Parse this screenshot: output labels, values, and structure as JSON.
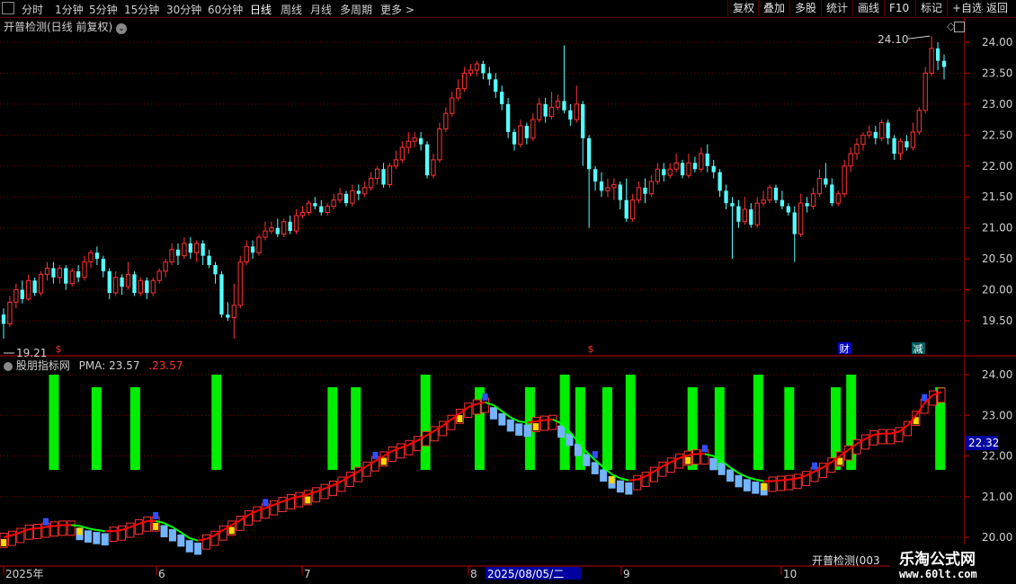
{
  "toolbar": {
    "periods": [
      "分时",
      "1分钟",
      "5分钟",
      "15分钟",
      "30分钟",
      "60分钟",
      "日线",
      "周线",
      "月线",
      "多周期",
      "更多"
    ],
    "active_period": "日线",
    "right_buttons": [
      "复权",
      "叠加",
      "多股",
      "统计",
      "画线",
      "F10",
      "标记",
      "+自选",
      "返回"
    ]
  },
  "main_chart": {
    "title": "开普检测(日线 前复权)",
    "high_label": "24.10",
    "low_label": "19.21",
    "markers": {
      "finance": "财",
      "reduce": "减",
      "dividend": "$"
    }
  },
  "indicator": {
    "name": "股朋指标网",
    "label": "PMA:",
    "value": "23.57",
    "value2": "23.57",
    "current_price_tag": "22.32"
  },
  "stock_label": "开普检测(003",
  "watermark": {
    "line1": "乐淘公式网",
    "line2": "www.60lt.com"
  },
  "colors": {
    "up": "#ff3232",
    "down": "#54ffff",
    "grid": "#7a0000",
    "axis": "#c00000",
    "pma_up": "#ff0000",
    "pma_down": "#00ff00",
    "bar_green": "#00ee00"
  },
  "chart_data": {
    "type": "candlestick",
    "price_axis_ticks": [
      "24.00",
      "23.50",
      "23.00",
      "22.50",
      "22.00",
      "21.50",
      "21.00",
      "20.50",
      "20.00",
      "19.50"
    ],
    "indicator_axis_ticks": [
      "24.00",
      "23.00",
      "22.00",
      "21.00",
      "20.00"
    ],
    "x_ticks": [
      "2025年",
      "6",
      "7",
      "8",
      "9",
      "10"
    ],
    "cursor_date": "2025/08/05/二",
    "candles": [
      [
        19.6,
        19.45,
        19.7,
        19.21
      ],
      [
        19.45,
        19.8,
        19.9,
        19.4
      ],
      [
        19.8,
        20.0,
        20.1,
        19.7
      ],
      [
        20.0,
        19.85,
        20.15,
        19.78
      ],
      [
        19.85,
        20.15,
        20.25,
        19.82
      ],
      [
        20.15,
        19.95,
        20.2,
        19.9
      ],
      [
        19.95,
        20.25,
        20.3,
        19.9
      ],
      [
        20.25,
        20.35,
        20.45,
        20.15
      ],
      [
        20.35,
        20.2,
        20.45,
        20.1
      ],
      [
        20.2,
        20.35,
        20.4,
        20.1
      ],
      [
        20.35,
        20.1,
        20.4,
        20.0
      ],
      [
        20.1,
        20.3,
        20.35,
        20.05
      ],
      [
        20.3,
        20.2,
        20.4,
        20.12
      ],
      [
        20.2,
        20.45,
        20.55,
        20.15
      ],
      [
        20.45,
        20.6,
        20.65,
        20.35
      ],
      [
        20.6,
        20.5,
        20.7,
        20.4
      ],
      [
        20.5,
        20.3,
        20.55,
        20.2
      ],
      [
        20.3,
        19.95,
        20.35,
        19.85
      ],
      [
        19.95,
        20.2,
        20.3,
        19.9
      ],
      [
        20.2,
        20.05,
        20.25,
        19.92
      ],
      [
        20.05,
        20.25,
        20.45,
        20.0
      ],
      [
        20.25,
        19.95,
        20.3,
        19.9
      ],
      [
        19.95,
        20.15,
        20.2,
        19.9
      ],
      [
        20.15,
        19.95,
        20.2,
        19.85
      ],
      [
        19.95,
        20.15,
        20.2,
        19.9
      ],
      [
        20.15,
        20.3,
        20.35,
        20.1
      ],
      [
        20.3,
        20.45,
        20.5,
        20.2
      ],
      [
        20.45,
        20.65,
        20.75,
        20.4
      ],
      [
        20.65,
        20.55,
        20.75,
        20.4
      ],
      [
        20.55,
        20.75,
        20.85,
        20.5
      ],
      [
        20.75,
        20.6,
        20.85,
        20.5
      ],
      [
        20.6,
        20.75,
        20.8,
        20.45
      ],
      [
        20.75,
        20.55,
        20.8,
        20.4
      ],
      [
        20.55,
        20.4,
        20.65,
        20.35
      ],
      [
        20.4,
        20.25,
        20.45,
        20.1
      ],
      [
        20.25,
        19.6,
        20.3,
        19.55
      ],
      [
        19.6,
        19.55,
        19.8,
        19.5
      ],
      [
        19.55,
        19.75,
        20.1,
        19.21
      ],
      [
        19.75,
        20.45,
        20.55,
        19.7
      ],
      [
        20.45,
        20.7,
        20.8,
        20.4
      ],
      [
        20.7,
        20.6,
        20.8,
        20.5
      ],
      [
        20.6,
        20.85,
        20.9,
        20.55
      ],
      [
        20.85,
        20.95,
        21.1,
        20.8
      ],
      [
        20.95,
        21.0,
        21.1,
        20.9
      ],
      [
        21.0,
        20.9,
        21.15,
        20.85
      ],
      [
        20.9,
        21.1,
        21.15,
        20.85
      ],
      [
        21.1,
        20.95,
        21.2,
        20.9
      ],
      [
        20.95,
        21.2,
        21.3,
        20.9
      ],
      [
        21.2,
        21.25,
        21.35,
        21.15
      ],
      [
        21.25,
        21.4,
        21.45,
        21.2
      ],
      [
        21.4,
        21.35,
        21.5,
        21.3
      ],
      [
        21.35,
        21.25,
        21.45,
        21.2
      ],
      [
        21.25,
        21.35,
        21.4,
        21.2
      ],
      [
        21.35,
        21.45,
        21.55,
        21.3
      ],
      [
        21.45,
        21.55,
        21.65,
        21.4
      ],
      [
        21.55,
        21.4,
        21.6,
        21.35
      ],
      [
        21.4,
        21.6,
        21.7,
        21.35
      ],
      [
        21.6,
        21.55,
        21.7,
        21.45
      ],
      [
        21.55,
        21.65,
        21.75,
        21.5
      ],
      [
        21.65,
        21.8,
        21.9,
        21.6
      ],
      [
        21.8,
        21.95,
        22.0,
        21.7
      ],
      [
        21.95,
        21.7,
        22.05,
        21.65
      ],
      [
        21.7,
        22.0,
        22.05,
        21.65
      ],
      [
        22.0,
        22.1,
        22.25,
        21.95
      ],
      [
        22.1,
        22.3,
        22.4,
        22.05
      ],
      [
        22.3,
        22.4,
        22.55,
        22.2
      ],
      [
        22.4,
        22.45,
        22.55,
        22.3
      ],
      [
        22.45,
        22.35,
        22.55,
        22.25
      ],
      [
        22.35,
        21.85,
        22.4,
        21.8
      ],
      [
        21.85,
        22.1,
        22.2,
        21.8
      ],
      [
        22.1,
        22.6,
        22.7,
        22.05
      ],
      [
        22.6,
        22.85,
        22.95,
        22.55
      ],
      [
        22.85,
        23.1,
        23.2,
        22.8
      ],
      [
        23.1,
        23.25,
        23.4,
        23.05
      ],
      [
        23.25,
        23.5,
        23.6,
        23.2
      ],
      [
        23.5,
        23.55,
        23.65,
        23.45
      ],
      [
        23.55,
        23.65,
        23.7,
        23.45
      ],
      [
        23.65,
        23.5,
        23.7,
        23.4
      ],
      [
        23.5,
        23.4,
        23.6,
        23.3
      ],
      [
        23.4,
        23.2,
        23.5,
        23.1
      ],
      [
        23.2,
        23.0,
        23.3,
        22.9
      ],
      [
        23.0,
        22.55,
        23.1,
        22.45
      ],
      [
        22.55,
        22.35,
        22.6,
        22.25
      ],
      [
        22.35,
        22.65,
        22.75,
        22.3
      ],
      [
        22.65,
        22.45,
        22.7,
        22.35
      ],
      [
        22.45,
        22.75,
        22.85,
        22.4
      ],
      [
        22.75,
        23.0,
        23.1,
        22.7
      ],
      [
        23.0,
        22.8,
        23.1,
        22.7
      ],
      [
        22.8,
        22.95,
        23.2,
        22.75
      ],
      [
        22.95,
        23.05,
        23.15,
        22.9
      ],
      [
        23.05,
        22.9,
        23.95,
        22.85
      ],
      [
        22.9,
        22.75,
        23.0,
        22.65
      ],
      [
        22.75,
        23.0,
        23.3,
        22.7
      ],
      [
        23.0,
        22.45,
        23.05,
        22.0
      ],
      [
        22.45,
        21.95,
        22.5,
        21.0
      ],
      [
        21.95,
        21.75,
        22.0,
        21.6
      ],
      [
        21.75,
        21.6,
        21.9,
        21.5
      ],
      [
        21.6,
        21.65,
        21.8,
        21.5
      ],
      [
        21.65,
        21.7,
        21.8,
        21.45
      ],
      [
        21.7,
        21.45,
        21.75,
        21.3
      ],
      [
        21.45,
        21.15,
        21.8,
        21.1
      ],
      [
        21.15,
        21.45,
        21.55,
        21.1
      ],
      [
        21.45,
        21.65,
        21.75,
        21.4
      ],
      [
        21.65,
        21.55,
        21.8,
        21.4
      ],
      [
        21.55,
        21.75,
        21.85,
        21.5
      ],
      [
        21.75,
        21.95,
        22.05,
        21.7
      ],
      [
        21.95,
        21.85,
        22.05,
        21.75
      ],
      [
        21.85,
        21.95,
        22.05,
        21.8
      ],
      [
        21.95,
        22.05,
        22.2,
        21.9
      ],
      [
        22.05,
        21.85,
        22.1,
        21.8
      ],
      [
        21.85,
        22.05,
        22.2,
        21.8
      ],
      [
        22.05,
        21.95,
        22.15,
        21.9
      ],
      [
        21.95,
        22.2,
        22.3,
        21.9
      ],
      [
        22.2,
        22.0,
        22.35,
        21.9
      ],
      [
        22.0,
        21.9,
        22.1,
        21.8
      ],
      [
        21.9,
        21.6,
        21.95,
        21.5
      ],
      [
        21.6,
        21.4,
        21.7,
        21.3
      ],
      [
        21.4,
        21.35,
        21.5,
        20.5
      ],
      [
        21.35,
        21.1,
        21.45,
        21.0
      ],
      [
        21.1,
        21.3,
        21.5,
        21.05
      ],
      [
        21.3,
        21.05,
        21.4,
        21.0
      ],
      [
        21.05,
        21.4,
        21.5,
        21.0
      ],
      [
        21.4,
        21.45,
        21.6,
        21.35
      ],
      [
        21.45,
        21.65,
        21.7,
        21.4
      ],
      [
        21.65,
        21.45,
        21.7,
        21.4
      ],
      [
        21.45,
        21.35,
        21.6,
        21.3
      ],
      [
        21.35,
        21.25,
        21.4,
        21.2
      ],
      [
        21.25,
        20.9,
        21.35,
        20.45
      ],
      [
        20.9,
        21.4,
        21.55,
        20.85
      ],
      [
        21.4,
        21.35,
        21.5,
        21.25
      ],
      [
        21.35,
        21.55,
        21.65,
        21.3
      ],
      [
        21.55,
        21.8,
        21.95,
        21.5
      ],
      [
        21.8,
        21.7,
        22.05,
        21.65
      ],
      [
        21.7,
        21.4,
        21.8,
        21.35
      ],
      [
        21.4,
        21.55,
        21.6,
        21.35
      ],
      [
        21.55,
        22.0,
        22.1,
        21.5
      ],
      [
        22.0,
        22.2,
        22.3,
        21.9
      ],
      [
        22.2,
        22.35,
        22.45,
        22.1
      ],
      [
        22.35,
        22.5,
        22.55,
        22.25
      ],
      [
        22.5,
        22.55,
        22.65,
        22.45
      ],
      [
        22.55,
        22.45,
        22.65,
        22.35
      ],
      [
        22.45,
        22.7,
        22.75,
        22.4
      ],
      [
        22.7,
        22.45,
        22.75,
        22.35
      ],
      [
        22.45,
        22.2,
        22.5,
        22.1
      ],
      [
        22.2,
        22.4,
        22.45,
        22.1
      ],
      [
        22.4,
        22.3,
        22.5,
        22.25
      ],
      [
        22.3,
        22.55,
        22.7,
        22.25
      ],
      [
        22.55,
        22.9,
        22.95,
        22.5
      ],
      [
        22.9,
        23.5,
        23.6,
        22.85
      ],
      [
        23.5,
        23.9,
        24.1,
        23.45
      ],
      [
        23.9,
        23.7,
        24.0,
        23.55
      ],
      [
        23.7,
        23.6,
        23.8,
        23.4
      ]
    ],
    "green_bar_indices": [
      13,
      24,
      34,
      55,
      85,
      91,
      109,
      123,
      136,
      145,
      149,
      156,
      162,
      178,
      185,
      195,
      203,
      215,
      219,
      242
    ],
    "pma": [
      20.0,
      20.05,
      20.12,
      20.2,
      20.22,
      20.25,
      20.28,
      20.3,
      20.3,
      20.28,
      20.22,
      20.18,
      20.15,
      20.15,
      20.18,
      20.25,
      20.33,
      20.4,
      20.4,
      20.35,
      20.25,
      20.12,
      19.98,
      19.92,
      19.96,
      20.05,
      20.18,
      20.3,
      20.42,
      20.55,
      20.65,
      20.72,
      20.8,
      20.88,
      20.95,
      21.0,
      21.05,
      21.12,
      21.2,
      21.28,
      21.38,
      21.5,
      21.62,
      21.75,
      21.88,
      22.0,
      22.12,
      22.2,
      22.28,
      22.38,
      22.5,
      22.62,
      22.75,
      22.9,
      23.05,
      23.2,
      23.28,
      23.32,
      23.25,
      23.1,
      22.95,
      22.85,
      22.82,
      22.85,
      22.88,
      22.9,
      22.8,
      22.6,
      22.35,
      22.1,
      21.9,
      21.72,
      21.55,
      21.45,
      21.4,
      21.42,
      21.5,
      21.62,
      21.75,
      21.85,
      21.95,
      22.02,
      22.05,
      22.05,
      22.0,
      21.88,
      21.72,
      21.58,
      21.48,
      21.42,
      21.38,
      21.38,
      21.4,
      21.42,
      21.45,
      21.52,
      21.62,
      21.72,
      21.85,
      22.0,
      22.15,
      22.3,
      22.42,
      22.52,
      22.55,
      22.55,
      22.6,
      22.75,
      23.0,
      23.3,
      23.5,
      23.57
    ]
  }
}
